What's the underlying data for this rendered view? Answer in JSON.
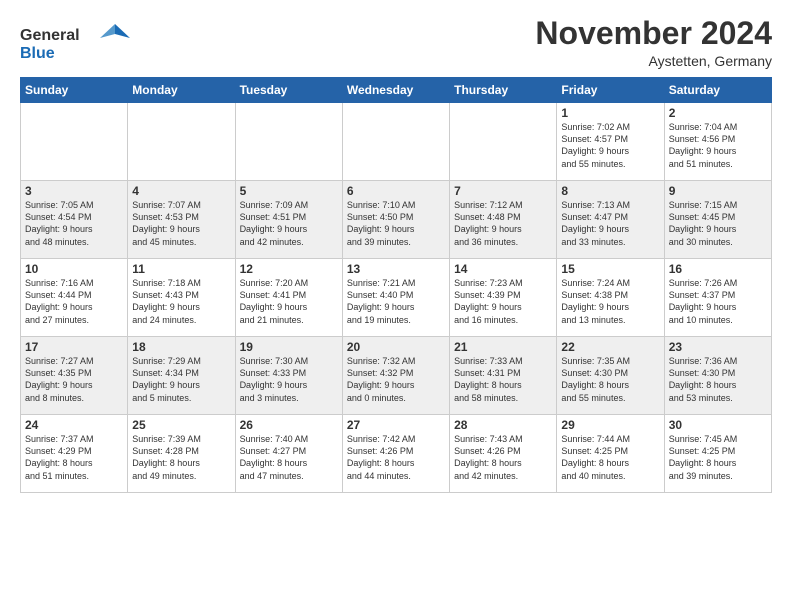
{
  "header": {
    "logo_line1": "General",
    "logo_line2": "Blue",
    "month": "November 2024",
    "location": "Aystetten, Germany"
  },
  "weekdays": [
    "Sunday",
    "Monday",
    "Tuesday",
    "Wednesday",
    "Thursday",
    "Friday",
    "Saturday"
  ],
  "weeks": [
    [
      {
        "day": "",
        "info": ""
      },
      {
        "day": "",
        "info": ""
      },
      {
        "day": "",
        "info": ""
      },
      {
        "day": "",
        "info": ""
      },
      {
        "day": "",
        "info": ""
      },
      {
        "day": "1",
        "info": "Sunrise: 7:02 AM\nSunset: 4:57 PM\nDaylight: 9 hours\nand 55 minutes."
      },
      {
        "day": "2",
        "info": "Sunrise: 7:04 AM\nSunset: 4:56 PM\nDaylight: 9 hours\nand 51 minutes."
      }
    ],
    [
      {
        "day": "3",
        "info": "Sunrise: 7:05 AM\nSunset: 4:54 PM\nDaylight: 9 hours\nand 48 minutes."
      },
      {
        "day": "4",
        "info": "Sunrise: 7:07 AM\nSunset: 4:53 PM\nDaylight: 9 hours\nand 45 minutes."
      },
      {
        "day": "5",
        "info": "Sunrise: 7:09 AM\nSunset: 4:51 PM\nDaylight: 9 hours\nand 42 minutes."
      },
      {
        "day": "6",
        "info": "Sunrise: 7:10 AM\nSunset: 4:50 PM\nDaylight: 9 hours\nand 39 minutes."
      },
      {
        "day": "7",
        "info": "Sunrise: 7:12 AM\nSunset: 4:48 PM\nDaylight: 9 hours\nand 36 minutes."
      },
      {
        "day": "8",
        "info": "Sunrise: 7:13 AM\nSunset: 4:47 PM\nDaylight: 9 hours\nand 33 minutes."
      },
      {
        "day": "9",
        "info": "Sunrise: 7:15 AM\nSunset: 4:45 PM\nDaylight: 9 hours\nand 30 minutes."
      }
    ],
    [
      {
        "day": "10",
        "info": "Sunrise: 7:16 AM\nSunset: 4:44 PM\nDaylight: 9 hours\nand 27 minutes."
      },
      {
        "day": "11",
        "info": "Sunrise: 7:18 AM\nSunset: 4:43 PM\nDaylight: 9 hours\nand 24 minutes."
      },
      {
        "day": "12",
        "info": "Sunrise: 7:20 AM\nSunset: 4:41 PM\nDaylight: 9 hours\nand 21 minutes."
      },
      {
        "day": "13",
        "info": "Sunrise: 7:21 AM\nSunset: 4:40 PM\nDaylight: 9 hours\nand 19 minutes."
      },
      {
        "day": "14",
        "info": "Sunrise: 7:23 AM\nSunset: 4:39 PM\nDaylight: 9 hours\nand 16 minutes."
      },
      {
        "day": "15",
        "info": "Sunrise: 7:24 AM\nSunset: 4:38 PM\nDaylight: 9 hours\nand 13 minutes."
      },
      {
        "day": "16",
        "info": "Sunrise: 7:26 AM\nSunset: 4:37 PM\nDaylight: 9 hours\nand 10 minutes."
      }
    ],
    [
      {
        "day": "17",
        "info": "Sunrise: 7:27 AM\nSunset: 4:35 PM\nDaylight: 9 hours\nand 8 minutes."
      },
      {
        "day": "18",
        "info": "Sunrise: 7:29 AM\nSunset: 4:34 PM\nDaylight: 9 hours\nand 5 minutes."
      },
      {
        "day": "19",
        "info": "Sunrise: 7:30 AM\nSunset: 4:33 PM\nDaylight: 9 hours\nand 3 minutes."
      },
      {
        "day": "20",
        "info": "Sunrise: 7:32 AM\nSunset: 4:32 PM\nDaylight: 9 hours\nand 0 minutes."
      },
      {
        "day": "21",
        "info": "Sunrise: 7:33 AM\nSunset: 4:31 PM\nDaylight: 8 hours\nand 58 minutes."
      },
      {
        "day": "22",
        "info": "Sunrise: 7:35 AM\nSunset: 4:30 PM\nDaylight: 8 hours\nand 55 minutes."
      },
      {
        "day": "23",
        "info": "Sunrise: 7:36 AM\nSunset: 4:30 PM\nDaylight: 8 hours\nand 53 minutes."
      }
    ],
    [
      {
        "day": "24",
        "info": "Sunrise: 7:37 AM\nSunset: 4:29 PM\nDaylight: 8 hours\nand 51 minutes."
      },
      {
        "day": "25",
        "info": "Sunrise: 7:39 AM\nSunset: 4:28 PM\nDaylight: 8 hours\nand 49 minutes."
      },
      {
        "day": "26",
        "info": "Sunrise: 7:40 AM\nSunset: 4:27 PM\nDaylight: 8 hours\nand 47 minutes."
      },
      {
        "day": "27",
        "info": "Sunrise: 7:42 AM\nSunset: 4:26 PM\nDaylight: 8 hours\nand 44 minutes."
      },
      {
        "day": "28",
        "info": "Sunrise: 7:43 AM\nSunset: 4:26 PM\nDaylight: 8 hours\nand 42 minutes."
      },
      {
        "day": "29",
        "info": "Sunrise: 7:44 AM\nSunset: 4:25 PM\nDaylight: 8 hours\nand 40 minutes."
      },
      {
        "day": "30",
        "info": "Sunrise: 7:45 AM\nSunset: 4:25 PM\nDaylight: 8 hours\nand 39 minutes."
      }
    ]
  ]
}
